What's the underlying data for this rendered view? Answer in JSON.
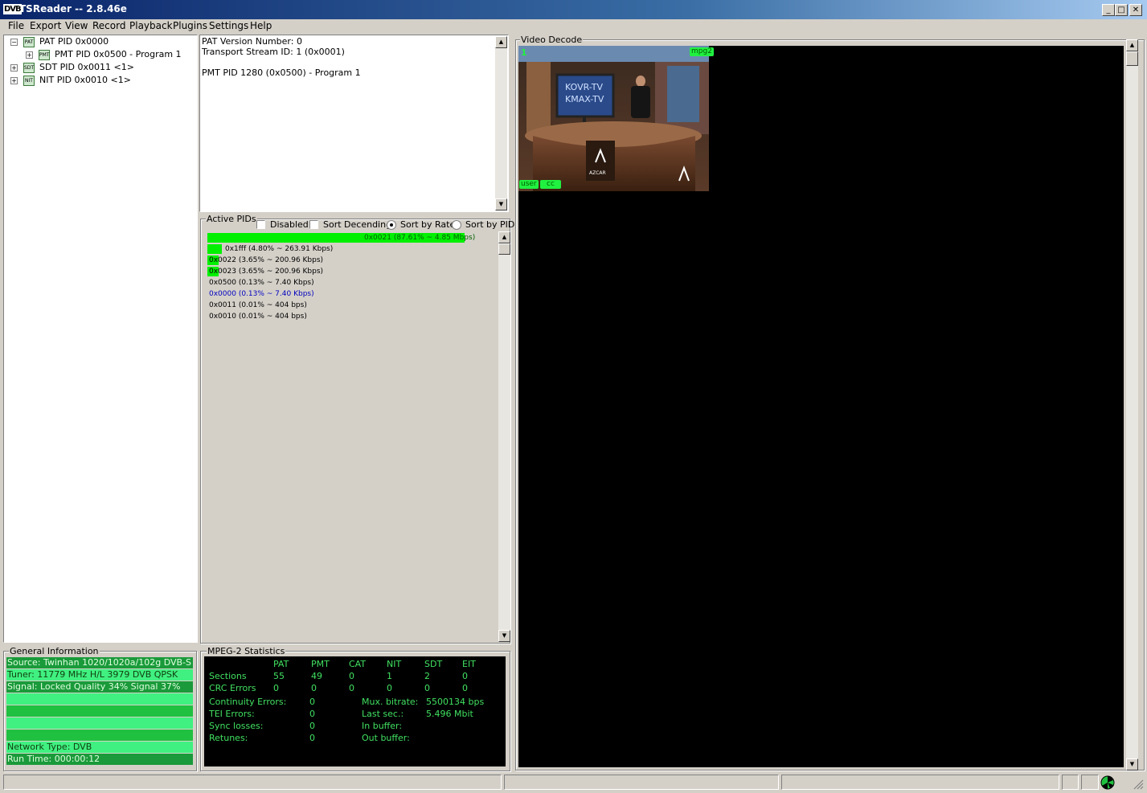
{
  "window": {
    "logo": "DVB",
    "title": "TSReader -- 2.8.46e"
  },
  "menu": [
    "File",
    "Export",
    "View",
    "Record",
    "Playback",
    "Plugins",
    "Settings",
    "Help"
  ],
  "tree": [
    {
      "label": "PAT PID 0x0000",
      "icon": "table-icon",
      "expander": "−"
    },
    {
      "label": "PMT PID 0x0500 - Program 1",
      "icon": "table-icon",
      "expander": "+"
    },
    {
      "label": "SDT PID 0x0011 <1>",
      "icon": "table-icon",
      "expander": "+"
    },
    {
      "label": "NIT PID 0x0010 <1>",
      "icon": "table-icon",
      "expander": "+"
    }
  ],
  "details": {
    "lines": [
      "PAT Version Number: 0",
      "Transport Stream ID: 1 (0x0001)",
      "",
      "PMT PID 1280 (0x0500) - Program 1"
    ]
  },
  "active_pids": {
    "title": "Active PIDs",
    "disabled_label": "Disabled",
    "sort_desc_label": "Sort Decending",
    "sort_rate_label": "Sort by Rate",
    "sort_pid_label": "Sort by PID",
    "sort_mode": "rate",
    "rows": [
      {
        "text": "0x0021 (87.61% ~ 4.85 Mbps)",
        "fraction": 0.8761,
        "color": "#006000"
      },
      {
        "text": "0x1fff (4.80% ~ 263.91 Kbps)",
        "fraction": 0.048,
        "color": "#000000"
      },
      {
        "text": "0x0022 (3.65% ~ 200.96 Kbps)",
        "fraction": 0.0365,
        "color": "#000000"
      },
      {
        "text": "0x0023 (3.65% ~ 200.96 Kbps)",
        "fraction": 0.0365,
        "color": "#000000"
      },
      {
        "text": "0x0500 (0.13% ~ 7.40 Kbps)",
        "fraction": 0.0013,
        "color": "#000000"
      },
      {
        "text": "0x0000 (0.13% ~ 7.40 Kbps)",
        "fraction": 0.0013,
        "color": "#0000c0"
      },
      {
        "text": "0x0011 (0.01% ~ 404 bps)",
        "fraction": 0.0001,
        "color": "#000000"
      },
      {
        "text": "0x0010 (0.01% ~ 404 bps)",
        "fraction": 0.0001,
        "color": "#000000"
      }
    ]
  },
  "video": {
    "title": "Video Decode",
    "channel_number": "1",
    "codec_tag": "mpg2",
    "user_tag": "user",
    "cc_tag": "cc",
    "monitor_text_1": "KOVR-TV",
    "monitor_text_2": "KMAX-TV",
    "desk_logo": "AZCAR"
  },
  "general_info": {
    "title": "General Information",
    "source": "Source: Twinhan 1020/1020a/102g DVB-S",
    "tuner": "Tuner: 11779 MHz H/L 3979 DVB QPSK",
    "signal": "Signal: Locked Quality 34% Signal 37%",
    "network": "Network Type: DVB",
    "runtime": "Run Time: 000:00:12"
  },
  "mpeg_stats": {
    "title": "MPEG-2 Statistics",
    "columns": [
      "PAT",
      "PMT",
      "CAT",
      "NIT",
      "SDT",
      "EIT"
    ],
    "sections_label": "Sections",
    "sections": [
      "55",
      "49",
      "0",
      "1",
      "2",
      "0"
    ],
    "crc_label": "CRC Errors",
    "crc": [
      "0",
      "0",
      "0",
      "0",
      "0",
      "0"
    ],
    "left": [
      {
        "label": "Continuity Errors:",
        "value": "0"
      },
      {
        "label": "TEI Errors:",
        "value": "0"
      },
      {
        "label": "Sync losses:",
        "value": "0"
      },
      {
        "label": "Retunes:",
        "value": "0"
      }
    ],
    "right": [
      {
        "label": "Mux. bitrate:",
        "value": "5500134 bps"
      },
      {
        "label": "Last sec.:",
        "value": "5.496 Mbit"
      },
      {
        "label": "In buffer:",
        "value": ""
      },
      {
        "label": "Out buffer:",
        "value": ""
      }
    ]
  }
}
